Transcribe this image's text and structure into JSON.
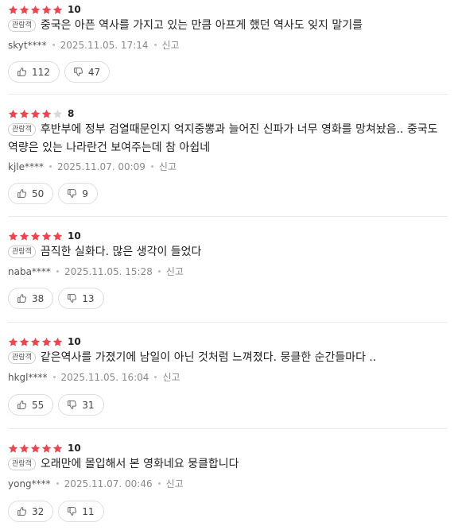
{
  "badge_label": "관람객",
  "report_label": "신고",
  "colors": {
    "star": "#f2424b",
    "star_empty": "#d9d9d9"
  },
  "reviews": [
    {
      "stars": 5,
      "score": "10",
      "comment": "중국은 아픈 역사를 가지고 있는 만큼 아프게 했던 역사도 잊지 말기를",
      "user": "skyt****",
      "date": "2025.11.05. 17:14",
      "likes": "112",
      "dislikes": "47"
    },
    {
      "stars": 4,
      "score": "8",
      "comment": "후반부에 정부 검열때문인지 억지중뽕과 늘어진 신파가 너무 영화를 망쳐놨음.. 중국도 역량은 있는 나라란건 보여주는데 참 아쉽네",
      "user": "kjle****",
      "date": "2025.11.07. 00:09",
      "likes": "50",
      "dislikes": "9"
    },
    {
      "stars": 5,
      "score": "10",
      "comment": "끔직한 실화다. 많은 생각이 들었다",
      "user": "naba****",
      "date": "2025.11.05. 15:28",
      "likes": "38",
      "dislikes": "13"
    },
    {
      "stars": 5,
      "score": "10",
      "comment": "같은역사를 가졌기에 남일이 아닌 것처럼 느껴졌다. 뭉클한 순간들마다 ..",
      "user": "hkgl****",
      "date": "2025.11.05. 16:04",
      "likes": "55",
      "dislikes": "31"
    },
    {
      "stars": 5,
      "score": "10",
      "comment": "오래만에 몰입해서 본 영화네요 뭉클합니다",
      "user": "yong****",
      "date": "2025.11.07. 00:46",
      "likes": "32",
      "dislikes": "11"
    }
  ]
}
